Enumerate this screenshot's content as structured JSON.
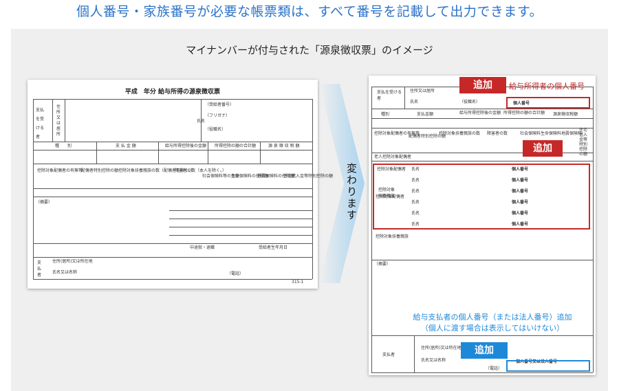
{
  "headline": "個人番号・家族番号が必要な帳票類は、すべて番号を記載して出力できます。",
  "subtitle": "マイナンバーが付与された「源泉徴収票」のイメージ",
  "change_label": "変わります",
  "old_form": {
    "title": "平成　年分 給与所得の源泉徴収票",
    "payee_label": "支払を受ける者",
    "address_label": "住所又は居所",
    "name_label": "氏名",
    "recipient_no": "（受給者番号）",
    "furigana": "（フリガナ）",
    "role": "（役職名）",
    "header_cols": [
      "種　　別",
      "支 払 金 額",
      "給与所得控除後の金額",
      "所得控除の額の合計額",
      "源 泉 徴 収 税 額"
    ],
    "mid_cols": [
      "控除対象配偶者の有無等",
      "配偶者特別控除の額",
      "控除対象扶養親族の数（配偶者を除く。）",
      "障害者の数（本人を除く。）",
      "社会保険料等の金額",
      "生命保険料の控除額",
      "地震保険料の控除額",
      "住宅借入金等特別控除の額"
    ],
    "summary": "（摘要）",
    "payer_address": "住所(居所)又は所在地",
    "payer_name": "氏名又は名称",
    "phone": "（電話）",
    "form_no": "315-1",
    "payer_label": "支払者",
    "remark_cols": [
      "中途就・退職",
      "受給者生年月日"
    ]
  },
  "new_form": {
    "payee_label": "支払を受ける者",
    "address_label": "住所又は居所",
    "name_label": "氏名",
    "role": "（役職名）",
    "personal_no": "個人番号",
    "header_cols": [
      "種別",
      "支払金額",
      "給与所得控除後の金額",
      "所得控除の額の合計額",
      "源泉徴収税額"
    ],
    "dep_cols": [
      "控除対象配偶者の有無等",
      "配偶者特別控除の額",
      "控除対象扶養親族の数",
      "障害者の数",
      "社会保険料",
      "生命保険料",
      "地震保険料",
      "住宅借入金等特別控除の額"
    ],
    "spouse_label": "控除対象配偶者",
    "dependents_label": "控除対象扶養親族",
    "old_spouse": "老人控除対象配偶者",
    "rows_name": "氏名",
    "summary": "（摘要）",
    "payer_label": "支払者",
    "payer_address": "住所(居所)又は所在地",
    "payer_name": "氏名又は名称",
    "payer_no": "個人番号又は法人番号",
    "phone": "（電話）"
  },
  "annotations": {
    "tag_add": "追加",
    "payee_note": "給与所得者の個人番号",
    "payer_note_1": "給与支払者の個人番号（または法人番号）追加",
    "payer_note_2": "（個人に渡す場合は表示してはいけない）"
  },
  "colors": {
    "headline": "#2b73c9",
    "highlight_red": "#c62828",
    "highlight_blue": "#1e88d8",
    "panel_bg": "#efefef"
  }
}
